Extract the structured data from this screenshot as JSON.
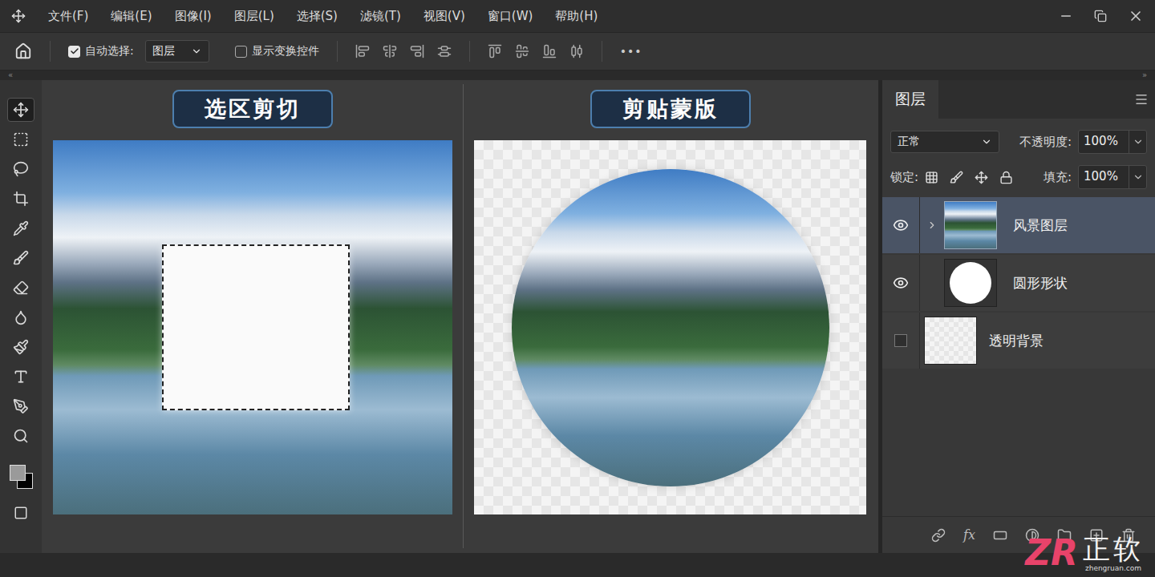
{
  "menu": {
    "items": [
      "文件(F)",
      "编辑(E)",
      "图像(I)",
      "图层(L)",
      "选择(S)",
      "滤镜(T)",
      "视图(V)",
      "窗口(W)",
      "帮助(H)"
    ]
  },
  "options_bar": {
    "auto_select": {
      "label": "自动选择:",
      "checked": true
    },
    "target": "图层",
    "transform_controls": {
      "label": "显示变换控件",
      "checked": false
    },
    "more": "•••"
  },
  "panel_toggles": {
    "left": "«",
    "right": "»"
  },
  "tools": [
    {
      "selected": true
    },
    {
      "selected": false
    },
    {
      "selected": false
    },
    {
      "selected": false
    },
    {
      "selected": false
    },
    {
      "selected": false
    },
    {
      "selected": false
    },
    {
      "selected": false
    },
    {
      "selected": false
    },
    {
      "selected": false
    },
    {
      "selected": false
    },
    {
      "selected": false
    }
  ],
  "canvas": {
    "panels": [
      {
        "title": "选区剪切",
        "kind": "selection"
      },
      {
        "title": "剪贴蒙版",
        "kind": "clip"
      }
    ]
  },
  "layers_panel": {
    "tab": "图层",
    "blend_mode": "正常",
    "opacity_label": "不透明度:",
    "opacity": "100%",
    "lock_label": "锁定:",
    "fill_label": "填充:",
    "fill": "100%",
    "fx": "fx",
    "layers": [
      {
        "name": "风景图层",
        "kind": "photo",
        "visible": true,
        "selected": true,
        "clipped": true
      },
      {
        "name": "圆形形状",
        "kind": "shape",
        "visible": true,
        "selected": false,
        "clipped": false
      },
      {
        "name": "透明背景",
        "kind": "background",
        "visible": false,
        "selected": false,
        "clipped": false
      }
    ]
  },
  "watermark": {
    "logo": "ZR",
    "name": "正软",
    "url": "zhengruan.com"
  }
}
